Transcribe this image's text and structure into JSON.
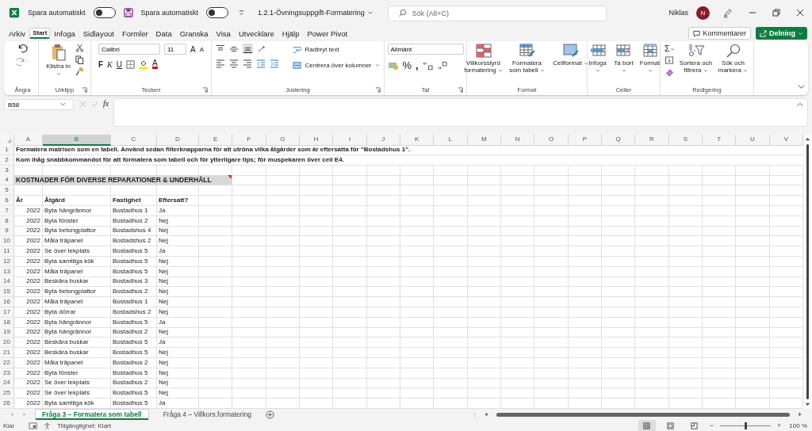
{
  "title_bar": {
    "autosave": [
      {
        "label": "Spara automatiskt",
        "on": false
      },
      {
        "label": "Spara automatiskt",
        "on": false
      }
    ],
    "file_name": "1.2.1-Övningsuppgift-Formatering",
    "search_placeholder": "Sök (Alt+C)",
    "user_name": "Niklas",
    "avatar": "N"
  },
  "menu_tabs": [
    {
      "label": "Arkiv",
      "selected": false
    },
    {
      "label": "Start",
      "selected": true
    },
    {
      "label": "Infoga",
      "selected": false
    },
    {
      "label": "Sidlayout",
      "selected": false
    },
    {
      "label": "Formler",
      "selected": false
    },
    {
      "label": "Data",
      "selected": false
    },
    {
      "label": "Granska",
      "selected": false
    },
    {
      "label": "Visa",
      "selected": false
    },
    {
      "label": "Utvecklare",
      "selected": false
    },
    {
      "label": "Hjälp",
      "selected": false
    },
    {
      "label": "Power Pivot",
      "selected": false
    }
  ],
  "actions": {
    "comments": "Kommentarer",
    "share": "Delning"
  },
  "ribbon": {
    "undo": {
      "label": "Ångra"
    },
    "clipboard": {
      "label": "Urklipp",
      "paste": "Klistra in"
    },
    "font": {
      "label": "Tecken",
      "family": "Calibri",
      "size": "11",
      "grow": "A",
      "shrink": "A",
      "bold": "F",
      "italic": "K",
      "underline": "U",
      "color_letter": "A"
    },
    "alignment": {
      "label": "Justering",
      "wrap": "Radbryt text",
      "merge": "Centrera över kolumner"
    },
    "number": {
      "label": "Tal",
      "format": "Allmänt",
      "percent": "%",
      "comma": ","
    },
    "styles": {
      "label": "Format",
      "items": [
        {
          "kind": "conditional",
          "label": "Villkorsstyrd formatering"
        },
        {
          "kind": "table",
          "label": "Formatera som tabell"
        },
        {
          "kind": "cell_style",
          "label": "Cellformat"
        }
      ]
    },
    "cells": {
      "label": "Celler",
      "items": [
        {
          "kind": "insert",
          "label": "Infoga"
        },
        {
          "kind": "delete",
          "label": "Ta bort"
        },
        {
          "kind": "format",
          "label": "Format"
        }
      ]
    },
    "editing": {
      "label": "Redigering",
      "sum": "Σ",
      "items": [
        {
          "kind": "sort",
          "label": "Sortera och filtrera"
        },
        {
          "kind": "find",
          "label": "Sök och markera"
        }
      ]
    }
  },
  "formula_bar": {
    "name_box": "B58",
    "function_label": "fx"
  },
  "sheet": {
    "columns": [
      {
        "label": "A",
        "selected": false
      },
      {
        "label": "B",
        "selected": true
      },
      {
        "label": "C",
        "selected": false
      },
      {
        "label": "D",
        "selected": false
      },
      {
        "label": "E",
        "selected": false
      },
      {
        "label": "F",
        "selected": false
      },
      {
        "label": "G",
        "selected": false
      },
      {
        "label": "H",
        "selected": false
      },
      {
        "label": "I",
        "selected": false
      },
      {
        "label": "J",
        "selected": false
      },
      {
        "label": "K",
        "selected": false
      },
      {
        "label": "L",
        "selected": false
      },
      {
        "label": "M",
        "selected": false
      },
      {
        "label": "N",
        "selected": false
      },
      {
        "label": "O",
        "selected": false
      },
      {
        "label": "P",
        "selected": false
      },
      {
        "label": "Q",
        "selected": false
      },
      {
        "label": "R",
        "selected": false
      },
      {
        "label": "S",
        "selected": false
      },
      {
        "label": "T",
        "selected": false
      },
      {
        "label": "U",
        "selected": false
      },
      {
        "label": "V",
        "selected": false
      }
    ],
    "rows": [
      {
        "number": "1",
        "kind": "note",
        "cells": [
          "Formatera matrisen som en tabell. Använd sedan filterknapparna för att utröna vilka åtgärder som är eftersatta för \"Bostadshus 1\"."
        ]
      },
      {
        "number": "2",
        "kind": "note",
        "cells": [
          "Kom ihåg snabbkommandot för att formatera som tabell och för ytterligare tips; för muspekaren över cell E4."
        ]
      },
      {
        "number": "3",
        "kind": "blank",
        "cells": []
      },
      {
        "number": "4",
        "kind": "title",
        "comment": true,
        "cells": [
          "KOSTNADER FÖR DIVERSE REPARATIONER & UNDERHÅLL"
        ]
      },
      {
        "number": "5",
        "kind": "blank",
        "cells": []
      },
      {
        "number": "6",
        "kind": "header",
        "cells": [
          "År",
          "Åtgärd",
          "Fastighet",
          "Eftersatt?"
        ]
      },
      {
        "number": "7",
        "kind": "data",
        "cells": [
          "2022",
          "Byta hängrännor",
          "Bostadhus 1",
          "Ja"
        ]
      },
      {
        "number": "8",
        "kind": "data",
        "cells": [
          "2022",
          "Byta fönster",
          "Bostadhus 2",
          "Nej"
        ]
      },
      {
        "number": "9",
        "kind": "data",
        "cells": [
          "2022",
          "Byta betongplattor",
          "Bostadshus 4",
          "Nej"
        ]
      },
      {
        "number": "10",
        "kind": "data",
        "cells": [
          "2022",
          "Måla träpanel",
          "Bostadshus 2",
          "Nej"
        ]
      },
      {
        "number": "11",
        "kind": "data",
        "cells": [
          "2022",
          "Se över lekplats",
          "Bostadhus 5",
          "Ja"
        ]
      },
      {
        "number": "12",
        "kind": "data",
        "cells": [
          "2022",
          "Byta samtliga kök",
          "Bostadhus 5",
          "Nej"
        ]
      },
      {
        "number": "13",
        "kind": "data",
        "cells": [
          "2022",
          "Måla träpanel",
          "Bostadhus 5",
          "Nej"
        ]
      },
      {
        "number": "14",
        "kind": "data",
        "cells": [
          "2022",
          "Beskära buskar",
          "Bostadhus 3",
          "Nej"
        ]
      },
      {
        "number": "15",
        "kind": "data",
        "cells": [
          "2022",
          "Byta betongplattor",
          "Bostadhus 2",
          "Nej"
        ]
      },
      {
        "number": "16",
        "kind": "data",
        "cells": [
          "2022",
          "Måla träpanel",
          "Bostadhus 1",
          "Nej"
        ]
      },
      {
        "number": "17",
        "kind": "data",
        "cells": [
          "2022",
          "Byta dörrar",
          "Bostadshus 2",
          "Nej"
        ]
      },
      {
        "number": "18",
        "kind": "data",
        "cells": [
          "2022",
          "Byta hängrännor",
          "Bostadhus 5",
          "Ja"
        ]
      },
      {
        "number": "19",
        "kind": "data",
        "cells": [
          "2022",
          "Byta hängrännor",
          "Bostadhus 2",
          "Nej"
        ]
      },
      {
        "number": "20",
        "kind": "data",
        "cells": [
          "2022",
          "Beskära buskar",
          "Bostadhus 5",
          "Ja"
        ]
      },
      {
        "number": "21",
        "kind": "data",
        "cells": [
          "2022",
          "Beskära buskar",
          "Bostadhus 5",
          "Nej"
        ]
      },
      {
        "number": "22",
        "kind": "data",
        "cells": [
          "2022",
          "Måla träpanel",
          "Bostadhus 2",
          "Nej"
        ]
      },
      {
        "number": "23",
        "kind": "data",
        "cells": [
          "2022",
          "Byta fönster",
          "Bostadhus 5",
          "Nej"
        ]
      },
      {
        "number": "24",
        "kind": "data",
        "cells": [
          "2022",
          "Se över lekplats",
          "Bostadhus 2",
          "Nej"
        ]
      },
      {
        "number": "25",
        "kind": "data",
        "cells": [
          "2022",
          "Se över lekplats",
          "Bostadhus 5",
          "Nej"
        ]
      },
      {
        "number": "26",
        "kind": "data",
        "cells": [
          "2022",
          "Byta samtliga kök",
          "Bostadhus 5",
          "Ja"
        ]
      }
    ]
  },
  "sheet_tabs": [
    {
      "label": "Fråga 3 – Formatera som tabell",
      "selected": true
    },
    {
      "label": "Fråga 4 – Villkors.formatering",
      "selected": false
    }
  ],
  "status_bar": {
    "mode": "Klar",
    "accessibility": "Tillgänglighet: Klart",
    "views": [
      {
        "kind": "normal",
        "selected": true
      },
      {
        "kind": "page_layout",
        "selected": false
      },
      {
        "kind": "page_break",
        "selected": false
      }
    ],
    "zoom_out": "−",
    "zoom_in": "+",
    "zoom": {
      "level": 0.5,
      "label": "100 %"
    }
  }
}
